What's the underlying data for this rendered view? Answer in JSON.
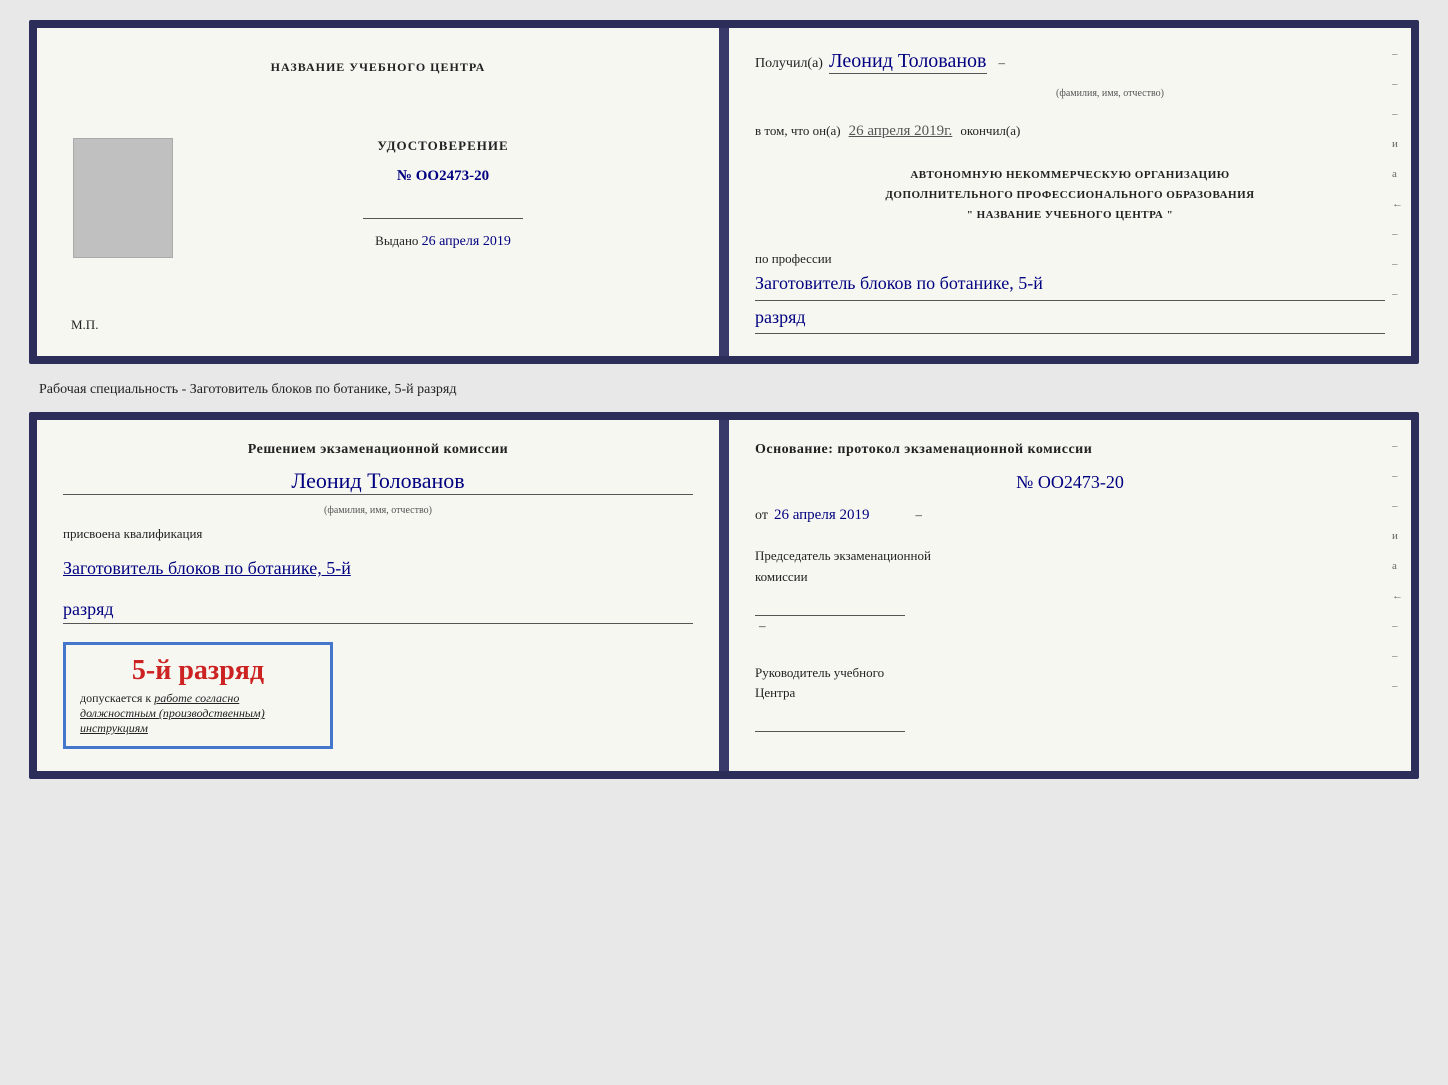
{
  "topCert": {
    "left": {
      "centerTitle": "НАЗВАНИЕ УЧЕБНОГО ЦЕНТРА",
      "certLabel": "УДОСТОВЕРЕНИЕ",
      "certNumber": "№ OO2473-20",
      "issuedLabel": "Выдано",
      "issuedDate": "26 апреля 2019",
      "mpLabel": "М.П."
    },
    "right": {
      "receivedLabel": "Получил(а)",
      "personName": "Леонид Толованов",
      "personNameSub": "(фамилия, имя, отчество)",
      "inThatLabel": "в том, что он(а)",
      "completedDate": "26 апреля 2019г.",
      "completedLabel": "окончил(а)",
      "orgLine1": "АВТОНОМНУЮ НЕКОММЕРЧЕСКУЮ ОРГАНИЗАЦИЮ",
      "orgLine2": "ДОПОЛНИТЕЛЬНОГО ПРОФЕССИОНАЛЬНОГО ОБРАЗОВАНИЯ",
      "orgLine3": "\"   НАЗВАНИЕ УЧЕБНОГО ЦЕНТРА   \"",
      "professionLabel": "по профессии",
      "professionValue": "Заготовитель блоков по ботанике, 5-й",
      "razryadValue": "разряд",
      "decoLines": [
        "-",
        "-",
        "-",
        "и",
        "а",
        "←",
        "-",
        "-",
        "-"
      ]
    }
  },
  "specialtyBanner": "Рабочая специальность - Заготовитель блоков по ботанике, 5-й разряд",
  "bottomCert": {
    "left": {
      "commissionTitle": "Решением экзаменационной комиссии",
      "personName": "Леонид Толованов",
      "personNameSub": "(фамилия, имя, отчество)",
      "assignedLabel": "присвоена квалификация",
      "professionValue": "Заготовитель блоков по ботанике, 5-й",
      "razryadValue": "разряд",
      "stampGrade": "5-й разряд",
      "stampAllowedLabel": "допускается к",
      "stampAllowedText": "работе согласно должностным (производственным) инструкциям"
    },
    "right": {
      "basisLabel": "Основание: протокол экзаменационной комиссии",
      "protocolNumber": "№  OO2473-20",
      "datePrefix": "от",
      "protocolDate": "26 апреля 2019",
      "chairmanLine1": "Председатель экзаменационной",
      "chairmanLine2": "комиссии",
      "directorLine1": "Руководитель учебного",
      "directorLine2": "Центра",
      "decoLines": [
        "-",
        "-",
        "-",
        "и",
        "а",
        "←",
        "-",
        "-",
        "-"
      ]
    }
  }
}
